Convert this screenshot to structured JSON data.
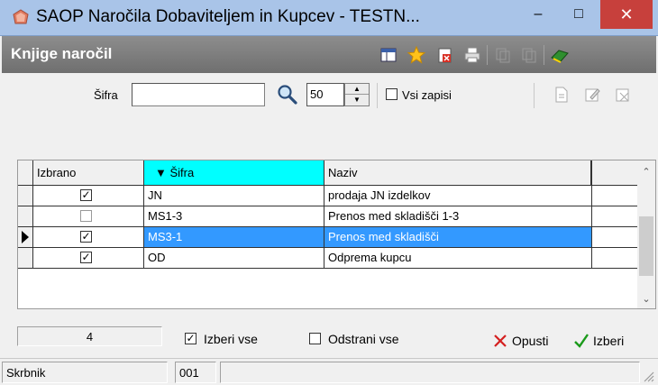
{
  "window": {
    "title": "SAOP Naročila Dobaviteljem in Kupcev - TESTN...",
    "min_glyph": "–",
    "max_glyph": "□",
    "close_glyph": "✕"
  },
  "header": {
    "title": "Knjige naročil"
  },
  "filter": {
    "sifra_label": "Šifra",
    "sifra_value": "",
    "count_value": "50",
    "vsi_zapisi_label": "Vsi zapisi",
    "vsi_zapisi_checked": false
  },
  "grid": {
    "columns": {
      "izbrano": "Izbrano",
      "sifra": "Šifra",
      "naziv": "Naziv"
    },
    "sort_glyph": "▼",
    "rows": [
      {
        "izbrano": true,
        "sifra": "JN",
        "naziv": "prodaja JN izdelkov",
        "selected": false
      },
      {
        "izbrano": false,
        "sifra": "MS1-3",
        "naziv": "Prenos med skladišči 1-3",
        "selected": false
      },
      {
        "izbrano": true,
        "sifra": "MS3-1",
        "naziv": "Prenos med skladišči",
        "selected": true
      },
      {
        "izbrano": true,
        "sifra": "OD",
        "naziv": "Odprema kupcu",
        "selected": false
      }
    ]
  },
  "bottom": {
    "count": "4",
    "izberi_vse_label": "Izberi vse",
    "izberi_vse_checked": true,
    "odstrani_vse_label": "Odstrani vse",
    "odstrani_vse_checked": false,
    "opusti_label": "Opusti",
    "izberi_label": "Izberi"
  },
  "status": {
    "skrbnik_label": "Skrbnik",
    "code": "001",
    "extra": ""
  },
  "colors": {
    "titlebar": "#a9c4e8",
    "header": "#7a7a7a",
    "selection": "#3399ff",
    "sort_column": "#00ffff",
    "close_button": "#c7403c"
  }
}
